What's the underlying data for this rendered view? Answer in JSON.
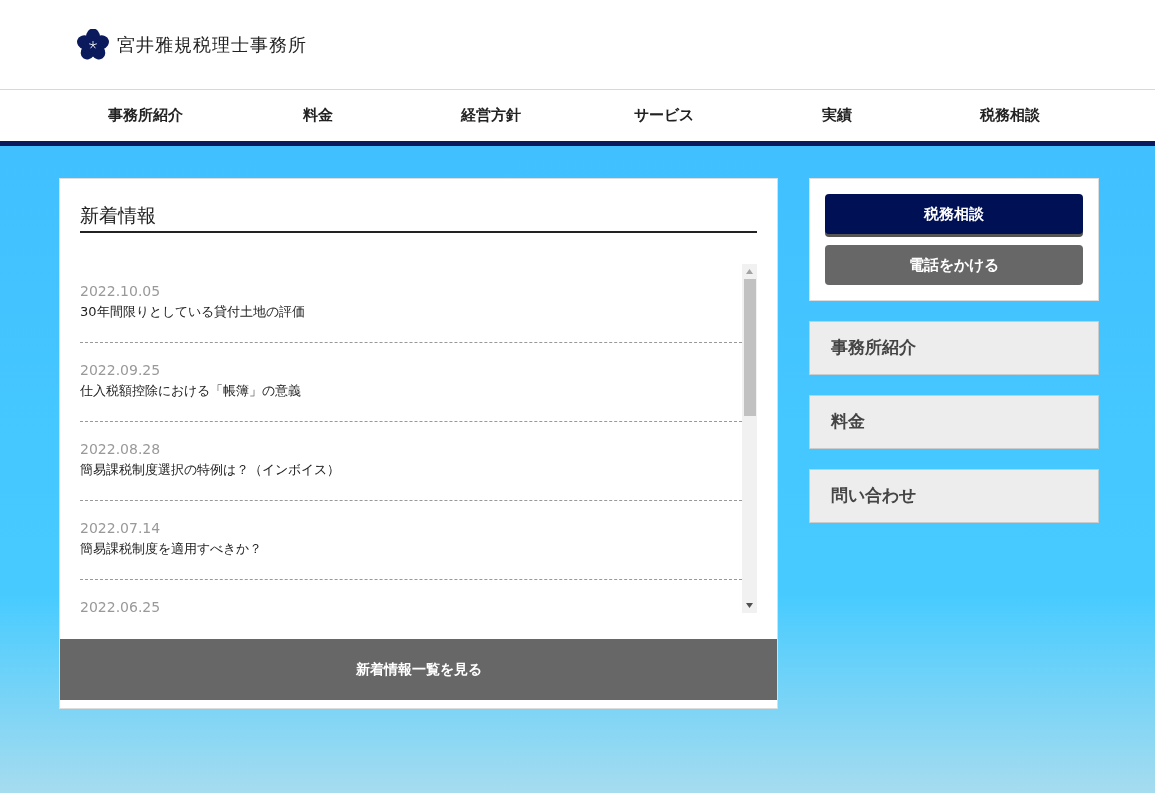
{
  "logo": {
    "text": "宮井雅規税理士事務所"
  },
  "nav": [
    "事務所紹介",
    "料金",
    "経営方針",
    "サービス",
    "実績",
    "税務相談"
  ],
  "news": {
    "title": "新着情報",
    "items": [
      {
        "date": "2022.10.05",
        "title": "30年間限りとしている貸付土地の評価"
      },
      {
        "date": "2022.09.25",
        "title": "仕入税額控除における「帳簿」の意義"
      },
      {
        "date": "2022.08.28",
        "title": "簡易課税制度選択の特例は？（インボイス）"
      },
      {
        "date": "2022.07.14",
        "title": "簡易課税制度を適用すべきか？"
      },
      {
        "date": "2022.06.25"
      }
    ],
    "more_button": "新着情報一覧を見る"
  },
  "side_buttons": [
    {
      "label": "税務相談",
      "kind": "primary"
    },
    {
      "label": "電話をかける",
      "kind": "secondary"
    }
  ],
  "side_links": [
    "事務所紹介",
    "料金",
    "問い合わせ"
  ]
}
